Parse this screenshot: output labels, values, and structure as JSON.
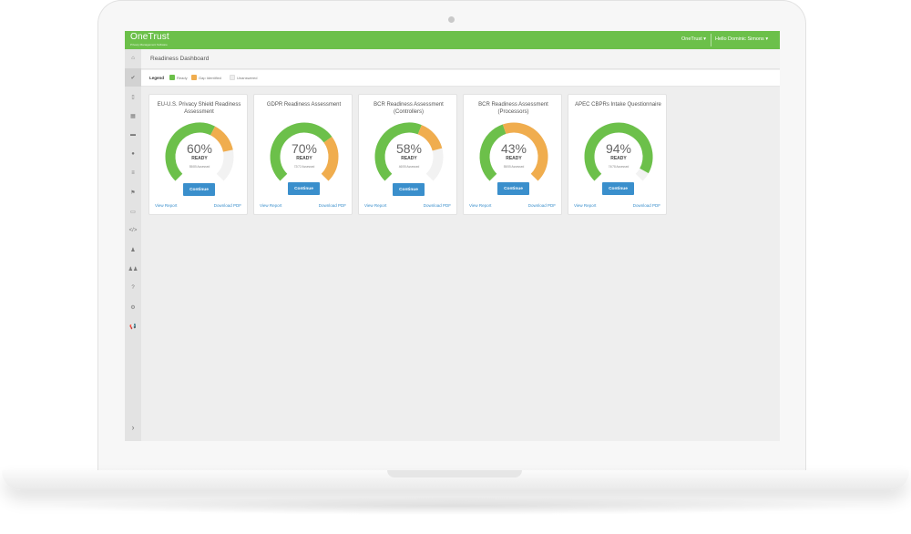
{
  "app": {
    "brand": "OneTrust",
    "brand_subtitle": "Privacy Management Software",
    "org_menu": "OneTrust ▾",
    "user_menu": "Hello Dominic Simons ▾"
  },
  "sidebar": {
    "items": [
      {
        "icon": "home-icon",
        "glyph": "⌂",
        "active": false
      },
      {
        "icon": "check-icon",
        "glyph": "✔",
        "active": true
      },
      {
        "icon": "document-icon",
        "glyph": "▯",
        "active": false
      },
      {
        "icon": "grid-icon",
        "glyph": "▦",
        "active": false
      },
      {
        "icon": "car-icon",
        "glyph": "▬",
        "active": false
      },
      {
        "icon": "globe-icon",
        "glyph": "●",
        "active": false
      },
      {
        "icon": "list-icon",
        "glyph": "≡",
        "active": false
      },
      {
        "icon": "flag-icon",
        "glyph": "⚑",
        "active": false
      },
      {
        "icon": "folder-icon",
        "glyph": "▭",
        "active": false
      },
      {
        "icon": "code-icon",
        "glyph": "</>",
        "active": false
      },
      {
        "icon": "user-icon",
        "glyph": "♟",
        "active": false
      },
      {
        "icon": "users-icon",
        "glyph": "♟♟",
        "active": false
      },
      {
        "icon": "help-icon",
        "glyph": "?",
        "active": false
      },
      {
        "icon": "settings-icon",
        "glyph": "⚙",
        "active": false
      },
      {
        "icon": "megaphone-icon",
        "glyph": "📢",
        "active": false,
        "color": "#2e86c1"
      }
    ],
    "expand_icon": "›"
  },
  "page": {
    "title": "Readiness Dashboard"
  },
  "legend": {
    "title": "Legend",
    "items": [
      {
        "label": "Ready",
        "color": "#6cc04a"
      },
      {
        "label": "Gap Identified",
        "color": "#f0ad4e"
      },
      {
        "label": "Unanswered",
        "color": "#eeeeee"
      }
    ]
  },
  "cards": [
    {
      "title": "EU-U.S. Privacy Shield Readiness Assessment",
      "percent": "60%",
      "ready_label": "READY",
      "assessed": "55/85 Assessed",
      "ready_frac": 0.6,
      "gap_frac": 0.19,
      "button": "Continue",
      "view_report": "View Report",
      "download_pdf": "Download PDF"
    },
    {
      "title": "GDPR Readiness Assessment",
      "percent": "70%",
      "ready_label": "READY",
      "assessed": "72/72 Assessed",
      "ready_frac": 0.7,
      "gap_frac": 0.3,
      "button": "Continue",
      "view_report": "View Report",
      "download_pdf": "Download PDF"
    },
    {
      "title": "BCR Readiness Assessment (Controllers)",
      "percent": "58%",
      "ready_label": "READY",
      "assessed": "46/55 Assessed",
      "ready_frac": 0.58,
      "gap_frac": 0.2,
      "button": "Continue",
      "view_report": "View Report",
      "download_pdf": "Download PDF"
    },
    {
      "title": "BCR Readiness Assessment (Processors)",
      "percent": "43%",
      "ready_label": "READY",
      "assessed": "55/55 Assessed",
      "ready_frac": 0.43,
      "gap_frac": 0.57,
      "button": "Continue",
      "view_report": "View Report",
      "download_pdf": "Download PDF"
    },
    {
      "title": "APEC CBPRs Intake Questionnaire",
      "percent": "94%",
      "ready_label": "READY",
      "assessed": "74/78 Assessed",
      "ready_frac": 0.94,
      "gap_frac": 0.0,
      "button": "Continue",
      "view_report": "View Report",
      "download_pdf": "Download PDF"
    }
  ]
}
